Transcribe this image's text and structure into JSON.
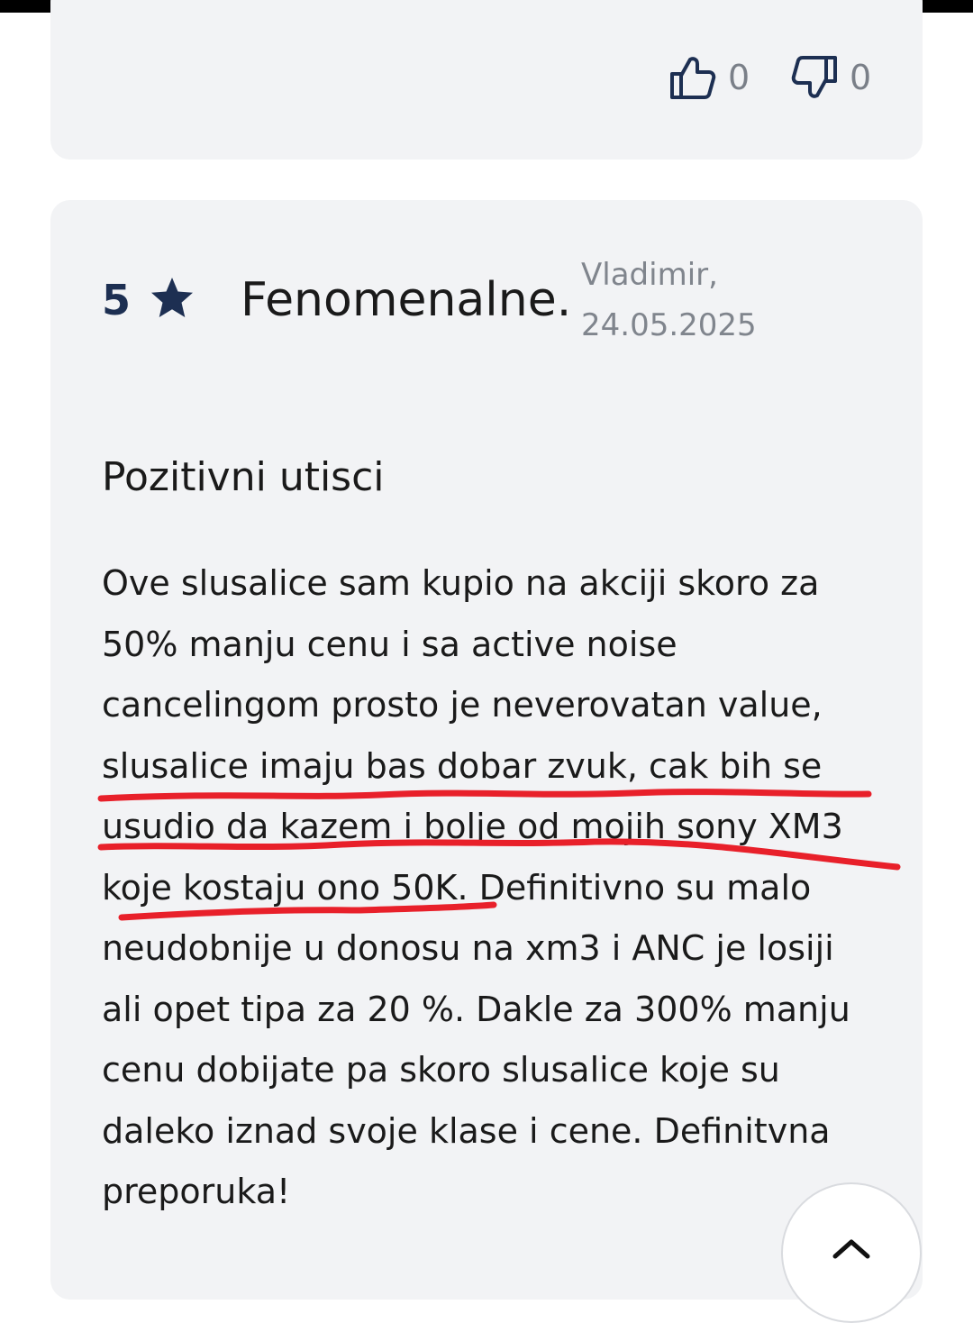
{
  "votes": {
    "up_count": "0",
    "down_count": "0"
  },
  "review": {
    "rating": "5",
    "title": "Fenomenalne.",
    "author": "Vladimir,",
    "date": "24.05.2025",
    "section_heading": "Pozitivni utisci",
    "body_lines": [
      "Ove slusalice sam kupio na akciji skoro za",
      "50% manju cenu i sa active noise",
      "cancelingom prosto je neverovatan value,",
      "slusalice imaju bas dobar zvuk, cak bih se",
      "usudio da kazem i bolje od mojih sony XM3",
      "koje kostaju ono 50K. Definitivno su malo",
      "neudobnije u donosu na xm3 i ANC je losiji",
      "ali opet tipa za 20 %. Dakle za 300% manju",
      "cenu dobijate pa skoro slusalice koje su",
      "daleko iznad svoje klase i cene. Definitvna",
      "preporuka!"
    ]
  },
  "icons": {
    "thumbs_up": "thumbs-up-icon",
    "thumbs_down": "thumbs-down-icon",
    "star": "star-icon",
    "scroll_top": "chevron-up-icon"
  },
  "colors": {
    "card_background": "#f2f3f5",
    "rating_color": "#1d2f52",
    "muted_text": "#80858d",
    "annotation_red": "#e8202a"
  }
}
